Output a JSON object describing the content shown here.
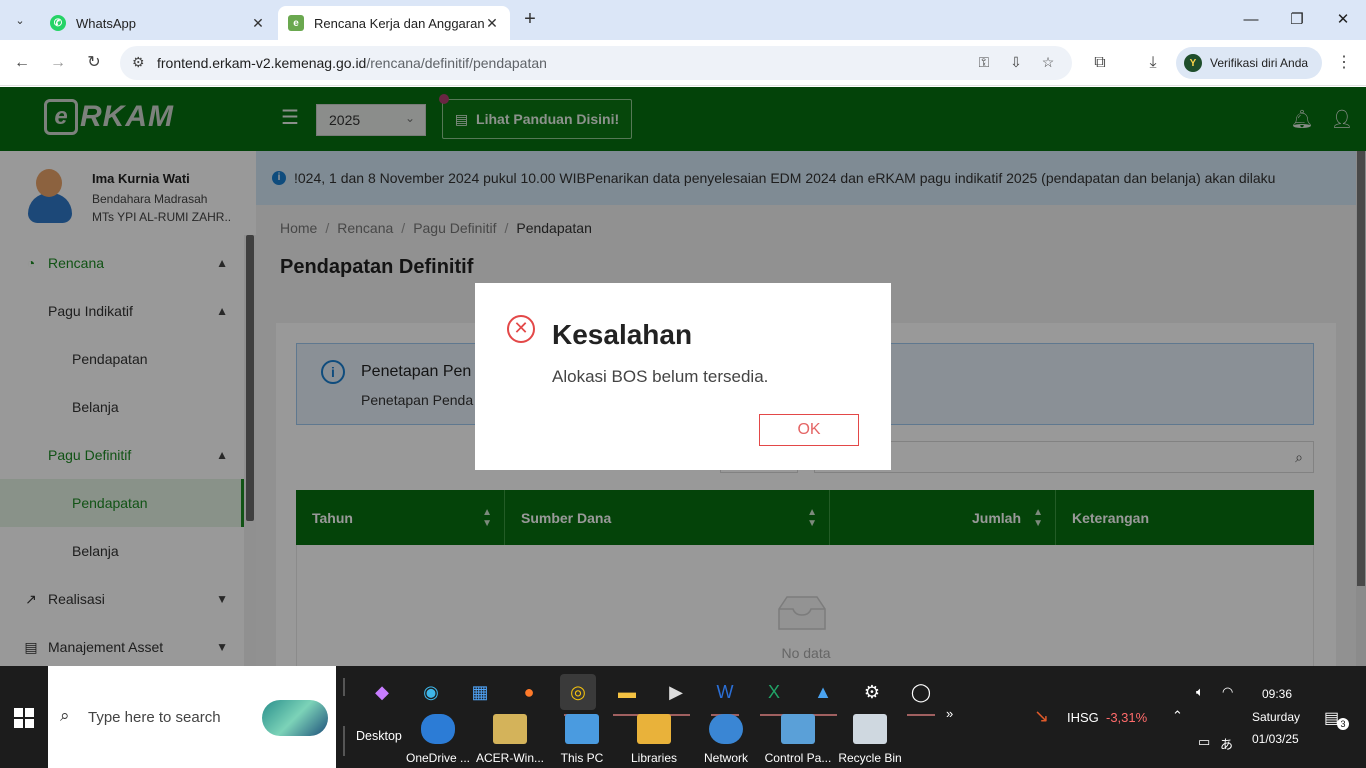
{
  "browser": {
    "tabs": [
      {
        "title": "WhatsApp",
        "active": false
      },
      {
        "title": "Rencana Kerja dan Anggaran M",
        "active": true
      }
    ],
    "url_host": "frontend.erkam-v2.kemenag.go.id",
    "url_path": "/rencana/definitif/pendapatan",
    "profile_button": "Verifikasi diri Anda",
    "profile_initial": "Y"
  },
  "header": {
    "logo_e": "e",
    "logo_rest": "RKAM",
    "year": "2025",
    "guide_button": "Lihat Panduan Disini!"
  },
  "sidebar": {
    "user_name": "Ima Kurnia Wati",
    "user_role": "Bendahara Madrasah",
    "user_org": "MTs YPI AL-RUMI ZAHR...",
    "items": [
      {
        "label": "Rencana"
      },
      {
        "label": "Pagu Indikatif"
      },
      {
        "label": "Pendapatan"
      },
      {
        "label": "Belanja"
      },
      {
        "label": "Pagu Definitif"
      },
      {
        "label": "Pendapatan"
      },
      {
        "label": "Belanja"
      },
      {
        "label": "Realisasi"
      },
      {
        "label": "Manajement Asset"
      }
    ]
  },
  "content": {
    "marquee": "!024, 1 dan 8 November 2024 pukul 10.00 WIBPenarikan data penyelesaian EDM 2024 dan eRKAM pagu indikatif 2025 (pendapatan dan belanja) akan dilaku",
    "breadcrumbs": [
      "Home",
      "Rencana",
      "Pagu Definitif",
      "Pendapatan"
    ],
    "page_title": "Pendapatan Definitif",
    "alert_title": "Penetapan Pen",
    "alert_desc": "Penetapan Penda",
    "table_headers": [
      "Tahun",
      "Sumber Dana",
      "Jumlah",
      "Keterangan"
    ],
    "no_data": "No data"
  },
  "dialog": {
    "title": "Kesalahan",
    "message": "Alokasi BOS belum tersedia.",
    "ok": "OK"
  },
  "taskbar": {
    "search_placeholder": "Type here to search",
    "desktop_label": "Desktop",
    "desktop_items": [
      "OneDrive ...",
      "ACER-Win...",
      "This PC",
      "Libraries",
      "Network",
      "Control Pa...",
      "Recycle Bin"
    ],
    "more": "»",
    "ihsg_label": "IHSG",
    "ihsg_value": "-3,31%",
    "time": "09:36",
    "day": "Saturday",
    "date": "01/03/25",
    "notif_count": "3"
  },
  "colors": {
    "brand_green": "#06700f",
    "error_red": "#e34848"
  }
}
